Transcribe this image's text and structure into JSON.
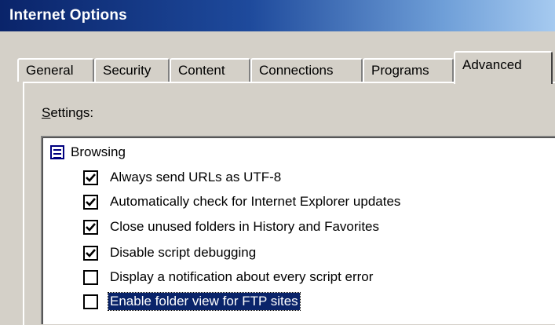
{
  "window": {
    "title": "Internet Options"
  },
  "tabs": [
    {
      "label": "General"
    },
    {
      "label": "Security"
    },
    {
      "label": "Content"
    },
    {
      "label": "Connections"
    },
    {
      "label": "Programs"
    },
    {
      "label": "Advanced"
    }
  ],
  "active_tab": "Advanced",
  "settings": {
    "label_mnemonic": "S",
    "label_rest": "ettings:",
    "group": {
      "label": "Browsing",
      "icon": "settings-group-icon"
    },
    "options": [
      {
        "label": "Always send URLs as UTF-8",
        "checked": true
      },
      {
        "label": "Automatically check for Internet Explorer updates",
        "checked": true
      },
      {
        "label": "Close unused folders in History and Favorites",
        "checked": true
      },
      {
        "label": "Disable script debugging",
        "checked": true
      },
      {
        "label": "Display a notification about every script error",
        "checked": false
      },
      {
        "label": "Enable folder view for FTP sites",
        "checked": false,
        "selected": true
      }
    ]
  },
  "colors": {
    "title_bar_start": "#0a246a",
    "title_bar_end": "#a6caf0",
    "selection": "#0a246a",
    "dialog_face": "#d4d0c8"
  }
}
